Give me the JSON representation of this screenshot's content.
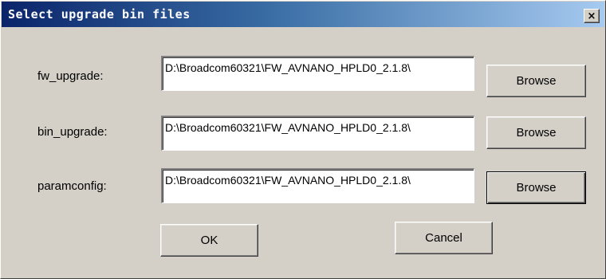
{
  "window": {
    "title": "Select upgrade bin files",
    "close_glyph": "×"
  },
  "fields": [
    {
      "label": "fw_upgrade:",
      "value": "D:\\Broadcom60321\\FW_AVNANO_HPLD0_2.1.8\\",
      "browse_label": "Browse"
    },
    {
      "label": "bin_upgrade:",
      "value": "D:\\Broadcom60321\\FW_AVNANO_HPLD0_2.1.8\\",
      "browse_label": "Browse"
    },
    {
      "label": "paramconfig:",
      "value": "D:\\Broadcom60321\\FW_AVNANO_HPLD0_2.1.8\\",
      "browse_label": "Browse"
    }
  ],
  "buttons": {
    "ok_label": "OK",
    "cancel_label": "Cancel"
  },
  "colors": {
    "face": "#d4d0c8",
    "titlebar_start": "#0a246a",
    "titlebar_end": "#a6caf0"
  }
}
